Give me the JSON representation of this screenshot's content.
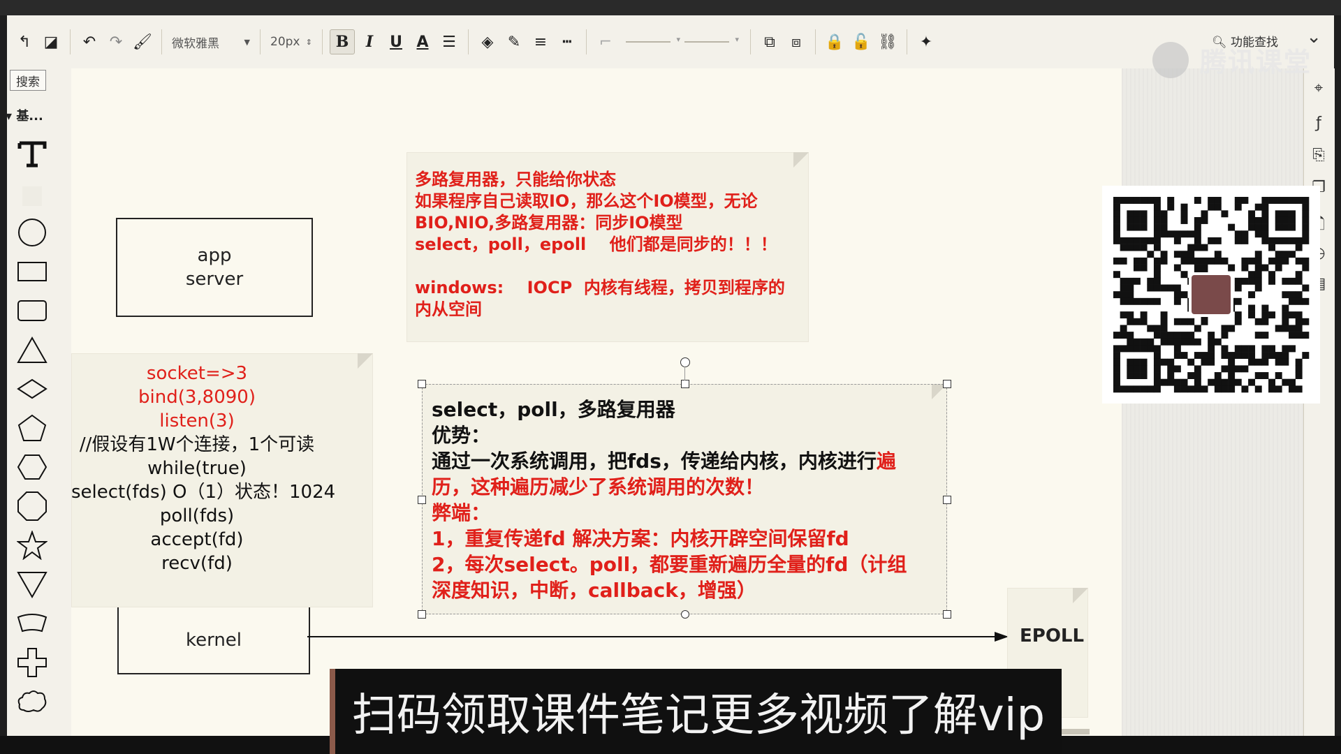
{
  "toolbar": {
    "font_family": "微软雅黑",
    "font_size": "20px",
    "bold": "B",
    "italic": "I",
    "underline": "U",
    "font_color": "A",
    "feature_search": "功能查找"
  },
  "left_panel": {
    "search_label": "搜索",
    "category_label": "基..."
  },
  "watermark": "腾讯课堂",
  "diagram": {
    "app_server_lines": [
      "app",
      "server"
    ],
    "kernel_label": "kernel",
    "epoll_label": "EPOLL",
    "note_top_lines": [
      "多路复用器，只能给你状态",
      "如果程序自己读取IO，那么这个IO模型，无论",
      "BIO,NIO,多路复用器：同步IO模型",
      "select，poll，epoll    他们都是同步的！！！",
      "",
      "windows:    IOCP  内核有线程，拷贝到程序的",
      "内从空间"
    ],
    "code_red_lines": [
      "socket=>3",
      "bind(3,8090)",
      "listen(3)"
    ],
    "code_black_lines": [
      "//假设有1W个连接，1个可读",
      "while(true)",
      "select(fds)  O（1）状态！1024",
      "poll(fds)",
      "accept(fd)",
      "recv(fd)"
    ],
    "select_note": {
      "line1": "select，poll，多路复用器",
      "line2": "优势：",
      "line3_black": "通过一次系统调用，把fds，传递给内核，内核进行",
      "line3_red": "遍",
      "line4": "历，这种遍历减少了系统调用的次数！",
      "line5": "弊端：",
      "line6": "1，重复传递fd  解决方案：内核开辟空间保留fd",
      "line7": "2，每次select。poll，都要重新遍历全量的fd（计组",
      "line8": "深度知识，中断，callback，增强）"
    }
  },
  "caption": "扫码领取课件笔记更多视频了解vip",
  "colors": {
    "red_text": "#e0201a",
    "canvas": "#fbf9ef",
    "toolbar": "#f3f1ea"
  }
}
